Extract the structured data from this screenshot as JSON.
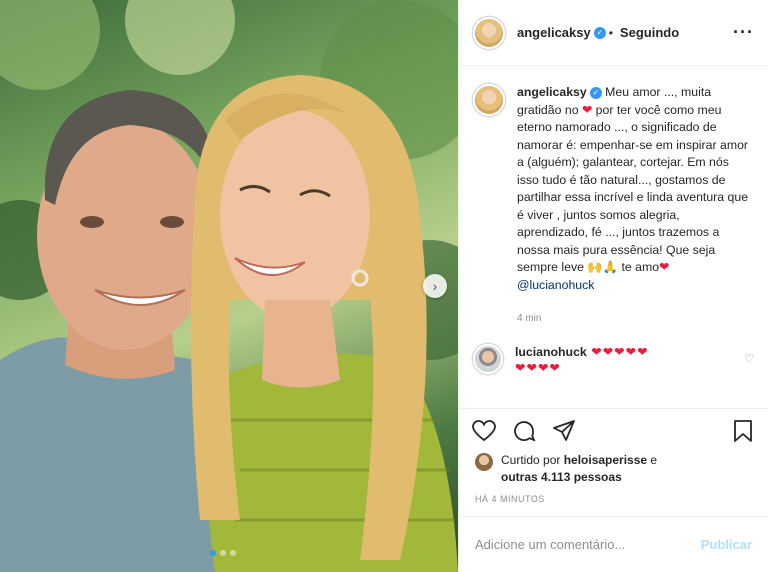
{
  "author": {
    "username": "angelicaksy",
    "status": "Seguindo"
  },
  "caption": {
    "username": "angelicaksy",
    "part1": "Meu amor ..., muita gratidão no ",
    "part2": " por ter você como meu eterno namorado ..., o significado de namorar é: empenhar-se em inspirar amor a (alguém); galantear, cortejar. Em nós isso tudo é tão natural..., gostamos de partilhar essa incrível e linda aventura que é viver , juntos somos alegria, aprendizado, fé ..., juntos trazemos a nossa mais pura essência! Que seja sempre leve ",
    "emojis_inline": "🙌🙏",
    "part3": " te amo",
    "mention": "@lucianohuck",
    "time": "4 min"
  },
  "reply": {
    "username": "lucianohuck",
    "hearts_line1": "❤❤❤❤❤",
    "hearts_line2": "❤❤❤❤"
  },
  "likes": {
    "prefix": "Curtido por ",
    "user": "heloisaperisse",
    "middle": " e",
    "others": "outras 4.113 pessoas"
  },
  "timestamp": "HÁ 4 MINUTOS",
  "comment_box": {
    "placeholder": "Adicione um comentário...",
    "publish": "Publicar"
  },
  "carousel": {
    "current": 1,
    "total": 3,
    "next_icon": "chevron-right-icon"
  },
  "colors": {
    "heart": "#ed1c3b",
    "verified": "#3897f0",
    "publish_disabled": "#b2dffc",
    "mention": "#00376b"
  }
}
